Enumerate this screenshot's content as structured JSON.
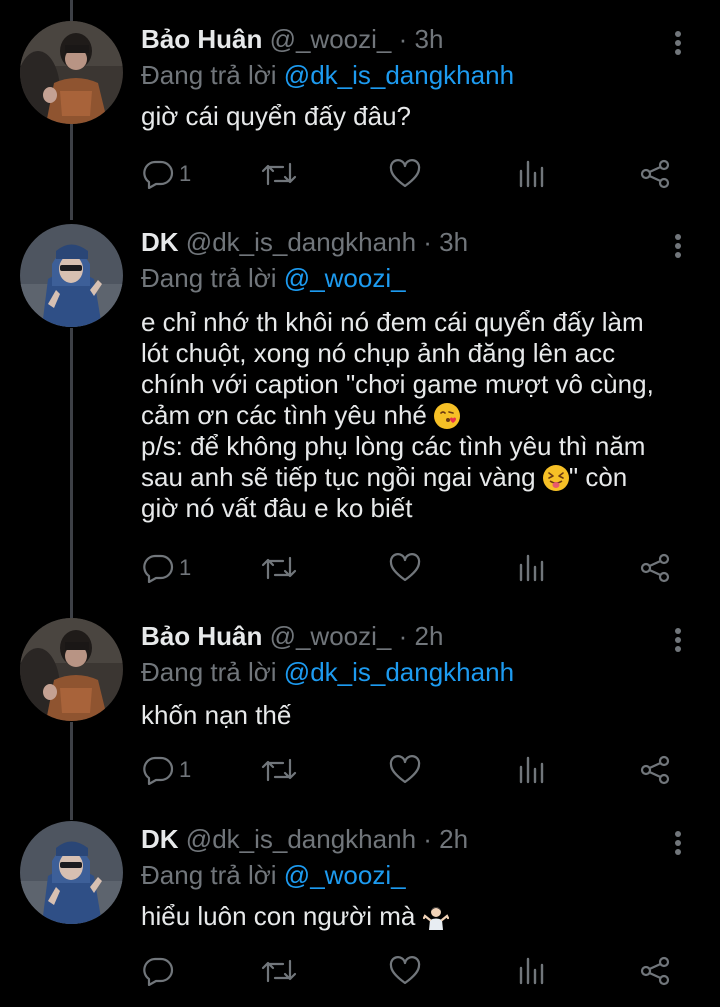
{
  "tweets": [
    {
      "name": "Bảo Huân",
      "handle": "@_woozi_",
      "time": "· 3h",
      "replying_label": "Đang trả lời",
      "replying_to": "@dk_is_dangkhanh",
      "text": "giờ cái quyển đấy đâu?",
      "reply_count": "1"
    },
    {
      "name": "DK",
      "handle": "@dk_is_dangkhanh",
      "time": "· 3h",
      "replying_label": "Đang trả lời",
      "replying_to": "@_woozi_",
      "text_part1": "e chỉ nhớ th khôi nó đem cái quyển đấy làm\nlót chuột, xong nó chụp ảnh đăng lên acc\nchính với caption \"chơi game mượt vô cùng,\ncảm ơn các tình yêu nhé ",
      "text_part2": "\np/s: để không phụ lòng các tình yêu thì năm\nsau anh sẽ tiếp tục ngồi ngai vàng ",
      "text_part3": "\" còn\ngiờ nó vất đâu e ko biết",
      "reply_count": "1"
    },
    {
      "name": "Bảo Huân",
      "handle": "@_woozi_",
      "time": "· 2h",
      "replying_label": "Đang trả lời",
      "replying_to": "@dk_is_dangkhanh",
      "text": "khốn nạn thế",
      "reply_count": "1"
    },
    {
      "name": "DK",
      "handle": "@dk_is_dangkhanh",
      "time": "· 2h",
      "replying_label": "Đang trả lời",
      "replying_to": "@_woozi_",
      "text": "hiểu luôn con người mà ",
      "reply_count": ""
    }
  ],
  "icons": {
    "reply": "reply-icon",
    "retweet": "retweet-icon",
    "like": "heart-icon",
    "analytics": "analytics-icon",
    "share": "share-icon",
    "more": "more-vertical-icon"
  },
  "colors": {
    "background": "#000000",
    "text": "#e7e9ea",
    "muted": "#71767b",
    "link": "#1d9bf0",
    "thread_line": "#3d4046"
  }
}
